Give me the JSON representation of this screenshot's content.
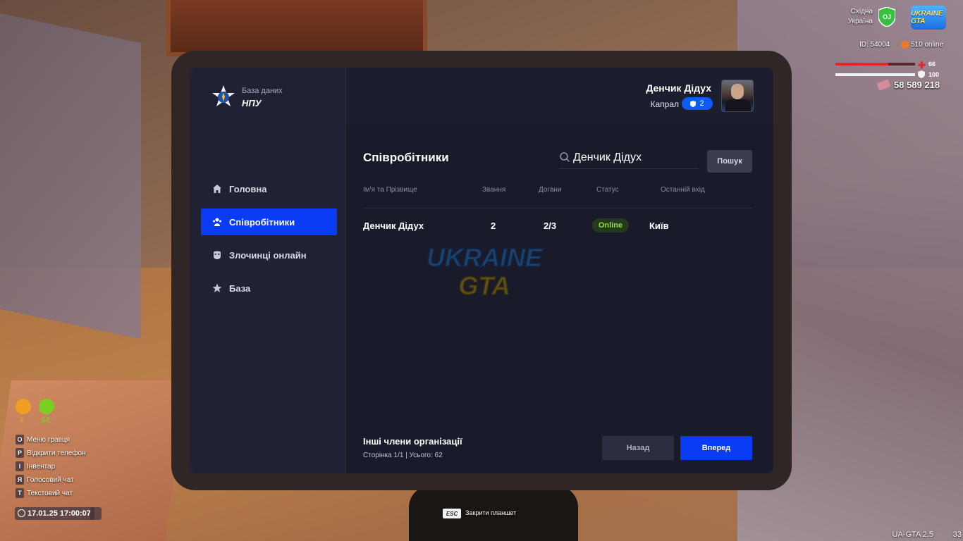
{
  "hud": {
    "region_line1": "Східна",
    "region_line2": "Україна",
    "region_badge": "OJ",
    "server_logo": "UKRAINE GTA",
    "player_id": "ID: 54004",
    "online": "510 online",
    "health_value": "66",
    "health_fraction": 0.66,
    "armor_value": "100",
    "armor_fraction": 1.0,
    "money": "58 589 218",
    "needs": [
      {
        "label": "0",
        "color": "#f0a020"
      },
      {
        "label": "GZ",
        "color": "#7ad020"
      }
    ],
    "hotkeys": [
      {
        "key": "O",
        "label": "Меню гравця"
      },
      {
        "key": "P",
        "label": "Відкрити телефон"
      },
      {
        "key": "I",
        "label": "Інвентар"
      },
      {
        "key": "Я",
        "label": "Голосовий чат"
      },
      {
        "key": "T",
        "label": "Текстовий чат"
      }
    ],
    "datetime": "17.01.25 17:00:07",
    "esc_key": "ESC",
    "esc_label": "Закрити планшет",
    "version": "UA-GTA 2.5",
    "fps": "33"
  },
  "tablet": {
    "logo_subtitle": "База даних",
    "logo_title": "НПУ",
    "nav": [
      {
        "label": "Головна",
        "icon": "home-icon",
        "active": false
      },
      {
        "label": "Співробітники",
        "icon": "users-icon",
        "active": true
      },
      {
        "label": "Злочинці онлайн",
        "icon": "mask-icon",
        "active": false
      },
      {
        "label": "База",
        "icon": "star-icon",
        "active": false
      }
    ],
    "user": {
      "name": "Денчик Дідух",
      "rank": "Капрал",
      "rank_number": "2"
    },
    "section_title": "Співробітники",
    "search": {
      "value": "Денчик Дідух",
      "button": "Пошук"
    },
    "table": {
      "headers": [
        "Ім'я та Прізвище",
        "Звання",
        "Догани",
        "Статус",
        "Останній вхід"
      ],
      "rows": [
        {
          "name": "Денчик Дідух",
          "rank": "2",
          "reprimands": "2/3",
          "status": "Online",
          "last_login": "Київ"
        }
      ]
    },
    "watermark": {
      "line1": "UKRAINE",
      "line2": "GTA"
    },
    "footer": {
      "title": "Інші члени організації",
      "page_info": "Сторінка 1/1 | Усього: 62",
      "back": "Назад",
      "next": "Вперед"
    },
    "colors": {
      "accent": "#0b3cf5",
      "online": "#8ee025"
    }
  }
}
